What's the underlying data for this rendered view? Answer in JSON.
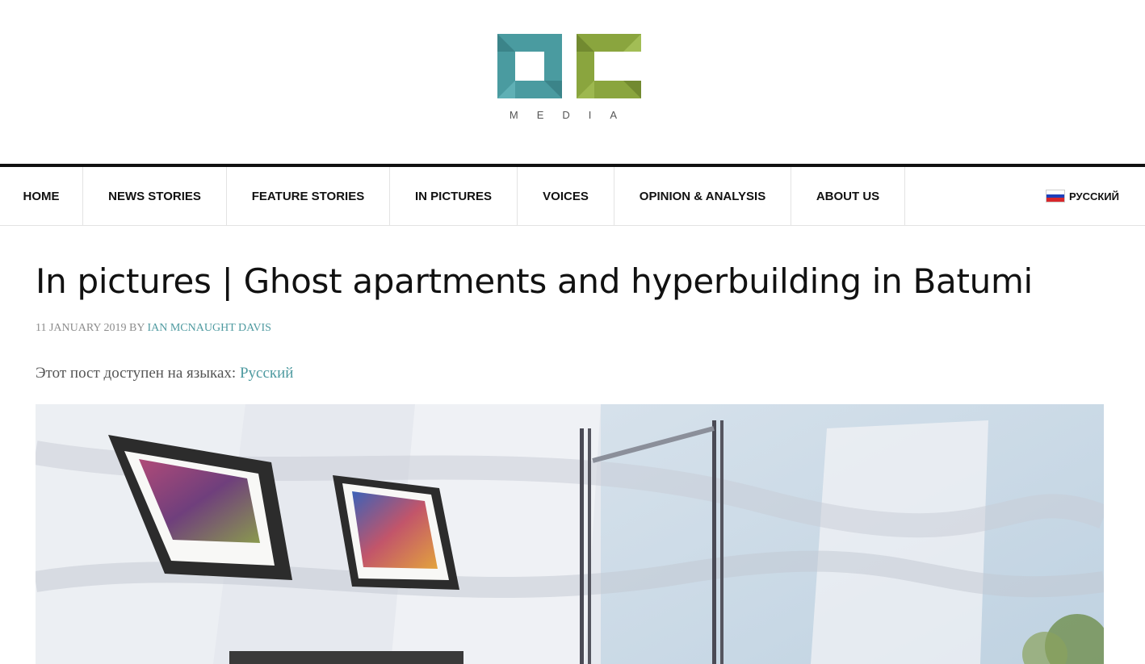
{
  "logo": {
    "wordmark": "OC",
    "subtitle": "MEDIA",
    "colors": {
      "o": "#4a9ba0",
      "c": "#8aa53e"
    }
  },
  "nav": {
    "items": [
      {
        "label": "HOME"
      },
      {
        "label": "NEWS STORIES"
      },
      {
        "label": "FEATURE STORIES"
      },
      {
        "label": "IN PICTURES"
      },
      {
        "label": "VOICES"
      },
      {
        "label": "OPINION & ANALYSIS"
      },
      {
        "label": "ABOUT US"
      }
    ],
    "language": {
      "label": "РУССКИЙ",
      "flag": "russia-flag-icon"
    }
  },
  "article": {
    "title": "In pictures | Ghost apartments and hyperbuilding in Batumi",
    "date": "11 JANUARY 2019",
    "by": "BY",
    "author": "IAN MCNAUGHT DAVIS",
    "language_notice": "Этот пост доступен на языках:",
    "language_link": "Русский"
  },
  "colors": {
    "accent": "#4e9aa0",
    "topbar": "#111111"
  }
}
